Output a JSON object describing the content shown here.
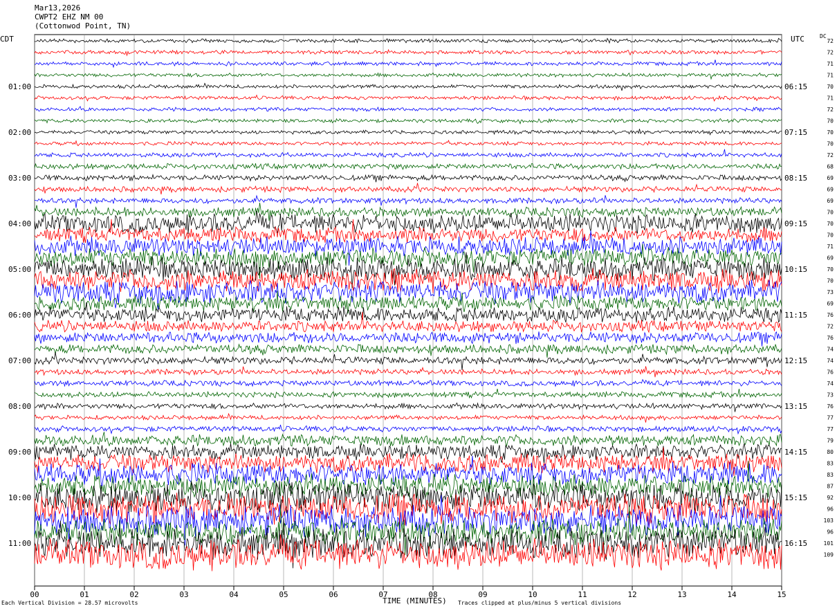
{
  "header": {
    "date": "Mar13,2026",
    "station": "CWPT2 EHZ NM 00",
    "location": "(Cottonwod Point, TN)"
  },
  "left_zone": "CDT",
  "right_zone": "UTC",
  "dc_label": "DC",
  "footer": {
    "scale_note": "Each Vertical Division =",
    "scale_value": "28.57 microvolts",
    "clip_note": "Traces clipped at plus/minus 5 vertical divisions"
  },
  "colors": {
    "trace_cycle": [
      "#000000",
      "#ff0000",
      "#0000ff",
      "#006400"
    ]
  },
  "chart_data": {
    "type": "line",
    "title": "",
    "xlabel": "TIME (MINUTES)",
    "ylabel": "",
    "x_ticks": [
      "00",
      "01",
      "02",
      "03",
      "04",
      "05",
      "06",
      "07",
      "08",
      "09",
      "10",
      "11",
      "12",
      "13",
      "14",
      "15"
    ],
    "xlim": [
      0,
      15
    ],
    "grid": true,
    "left_hour_labels": [
      "01:00",
      "02:00",
      "03:00",
      "04:00",
      "05:00",
      "06:00",
      "07:00",
      "08:00",
      "09:00",
      "10:00",
      "11:00"
    ],
    "right_hour_labels": [
      "06:15",
      "07:15",
      "08:15",
      "09:15",
      "10:15",
      "11:15",
      "12:15",
      "13:15",
      "14:15",
      "15:15",
      "16:15"
    ],
    "dc_offsets": [
      72,
      72,
      71,
      71,
      70,
      71,
      72,
      70,
      70,
      70,
      72,
      68,
      69,
      69,
      69,
      70,
      70,
      70,
      71,
      69,
      70,
      70,
      73,
      69,
      76,
      72,
      76,
      74,
      74,
      76,
      74,
      73,
      76,
      77,
      77,
      79,
      80,
      83,
      83,
      87,
      92,
      96,
      103,
      96,
      101,
      109
    ],
    "trace_amplitudes": [
      1,
      1,
      1,
      1,
      1,
      1,
      1,
      1,
      1,
      1,
      1.2,
      1.5,
      1.5,
      1.5,
      1.5,
      2.5,
      5,
      4,
      5,
      5,
      6,
      6,
      6,
      4,
      4,
      3,
      3,
      2.5,
      2,
      1.5,
      1.5,
      1.5,
      1.5,
      1.2,
      1.5,
      3,
      4,
      5,
      6,
      6,
      8,
      8,
      8,
      7,
      8,
      8
    ]
  }
}
